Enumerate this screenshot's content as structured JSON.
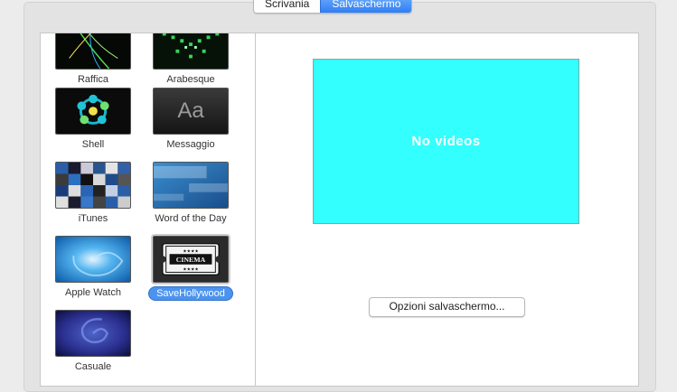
{
  "tabs": [
    {
      "label": "Scrivania",
      "active": false
    },
    {
      "label": "Salvaschermo",
      "active": true
    }
  ],
  "screensavers": [
    {
      "label": "Raffica",
      "icon": "raffica-thumbnail",
      "selected": false
    },
    {
      "label": "Arabesque",
      "icon": "arabesque-thumbnail",
      "selected": false
    },
    {
      "label": "Shell",
      "icon": "shell-thumbnail",
      "selected": false
    },
    {
      "label": "Messaggio",
      "icon": "messaggio-thumbnail",
      "thumb_text": "Aa",
      "selected": false
    },
    {
      "label": "iTunes",
      "icon": "itunes-thumbnail",
      "selected": false
    },
    {
      "label": "Word of the Day",
      "icon": "word-of-the-day-thumbnail",
      "selected": false
    },
    {
      "label": "Apple Watch",
      "icon": "apple-watch-thumbnail",
      "selected": false
    },
    {
      "label": "SaveHollywood",
      "icon": "cinema-ticket-thumbnail",
      "selected": true
    },
    {
      "label": "Casuale",
      "icon": "casuale-thumbnail",
      "selected": false
    }
  ],
  "preview": {
    "message": "No videos",
    "background": "#33ffff"
  },
  "options_button": "Opzioni salvaschermo..."
}
